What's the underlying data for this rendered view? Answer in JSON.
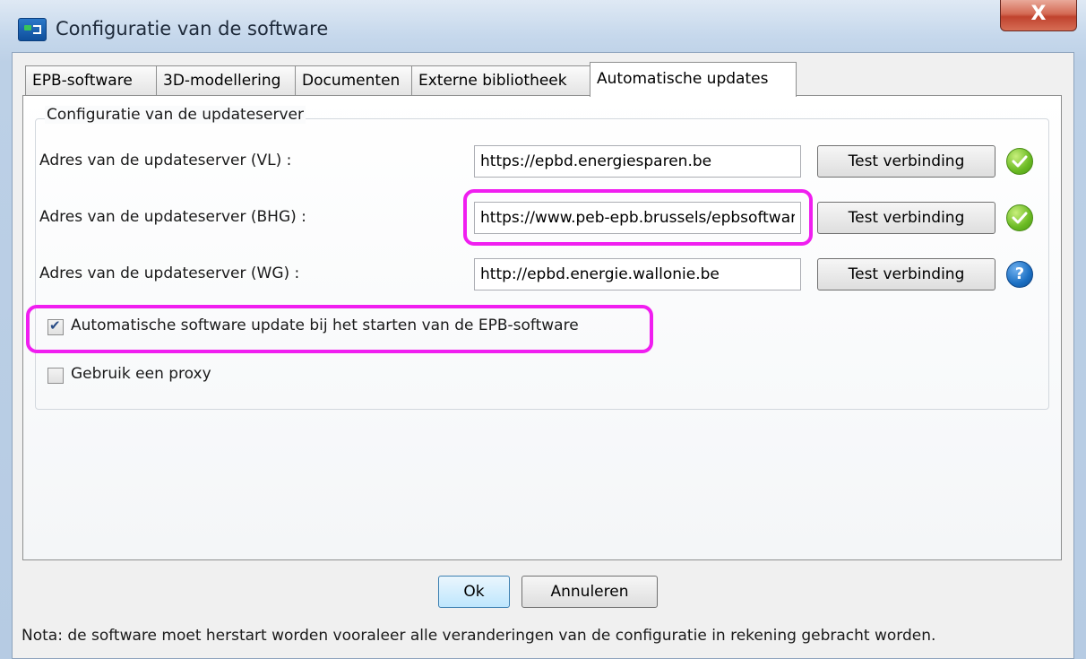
{
  "window": {
    "title": "Configuratie van de software",
    "close_glyph": "X"
  },
  "tabs": [
    {
      "label": "EPB-software",
      "active": false
    },
    {
      "label": "3D-modellering",
      "active": false
    },
    {
      "label": "Documenten",
      "active": false
    },
    {
      "label": "Externe bibliotheek",
      "active": false
    },
    {
      "label": "Automatische updates",
      "active": true
    }
  ],
  "group": {
    "title": "Configuratie van de updateserver",
    "servers": [
      {
        "label": "Adres van de updateserver (VL) :",
        "value": "https://epbd.energiesparen.be",
        "button": "Test verbinding",
        "status": "ok-check-icon"
      },
      {
        "label": "Adres van de updateserver (BHG) :",
        "value": "https://www.peb-epb.brussels/epbsoftware",
        "button": "Test verbinding",
        "status": "ok-check-icon"
      },
      {
        "label": "Adres van de updateserver (WG) :",
        "value": "http://epbd.energie.wallonie.be",
        "button": "Test verbinding",
        "status": "help-icon"
      }
    ],
    "options": [
      {
        "label": "Automatische software update bij het starten van de EPB-software",
        "checked": true
      },
      {
        "label": "Gebruik een proxy",
        "checked": false
      }
    ]
  },
  "buttons": {
    "ok": "Ok",
    "cancel": "Annuleren"
  },
  "note": "Nota: de software moet herstart worden vooraleer alle veranderingen van de configuratie in rekening gebracht worden.",
  "colors": {
    "highlight": "#f01ef0",
    "ok_status": "#6aba23",
    "help_status": "#1b6fc2",
    "close_button": "#c0432e"
  }
}
